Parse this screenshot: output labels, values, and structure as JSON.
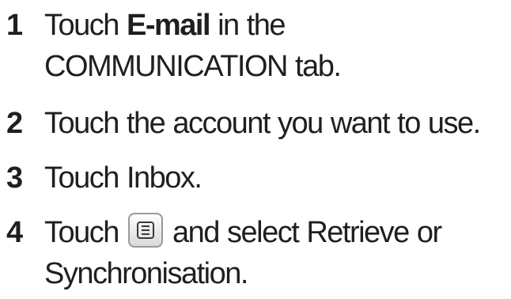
{
  "steps": [
    {
      "number": "1",
      "line1_before": "Touch ",
      "line1_bold": "E-mail",
      "line1_after": " in the",
      "line2": "COMMUNICATION tab."
    },
    {
      "number": "2",
      "line1": "Touch the account you want to use."
    },
    {
      "number": "3",
      "line1": "Touch Inbox."
    },
    {
      "number": "4",
      "line1_before": "Touch",
      "line1_icon": "menu-key-icon",
      "line1_after": "and select Retrieve or",
      "line2": "Synchronisation."
    }
  ]
}
